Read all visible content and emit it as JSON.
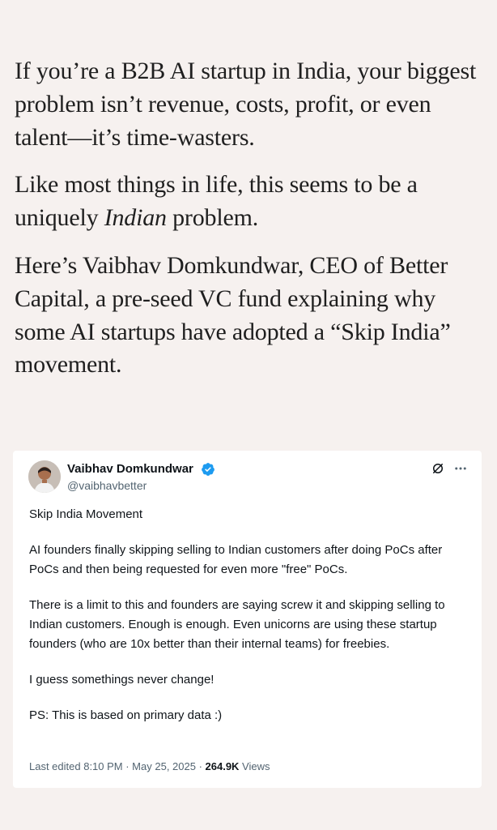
{
  "article": {
    "paragraph_1": "If you’re a B2B AI startup in India, your biggest problem isn’t revenue, costs, profit, or even talent—it’s time-wasters.",
    "paragraph_2_before": "Like most things in life, this seems to be a uniquely ",
    "paragraph_2_emphasis": "Indian",
    "paragraph_2_after": " problem.",
    "paragraph_3": "Here’s Vaibhav Domkundwar, CEO of Better Capital, a pre-seed VC fund explaining why some AI startups have adopted a “Skip India” movement."
  },
  "tweet": {
    "author_name": "Vaibhav Domkundwar",
    "author_handle": "@vaibhavbetter",
    "verified": true,
    "icons": {
      "verified": "verified-badge-icon",
      "grok": "grok-icon",
      "more": "more-options-icon"
    },
    "body": {
      "line_1": "Skip India Movement",
      "line_2": "AI founders finally skipping selling to Indian customers after doing PoCs after PoCs and then being requested for even more \"free\" PoCs.",
      "line_3": "There is a limit to this and founders are saying screw it and skipping selling to Indian customers. Enough is enough. Even unicorns are using these startup founders (who are 10x better than their internal teams) for freebies.",
      "line_4": "I guess somethings never change!",
      "line_5": "PS: This is based on primary data :)"
    },
    "meta": {
      "edited_prefix": "Last edited 8:10 PM · May 25, 2025 · ",
      "views_count": "264.9K",
      "views_label": " Views"
    }
  },
  "colors": {
    "background": "#f6f1ef",
    "article_text": "#1f1f1f",
    "tweet_bg": "#ffffff",
    "muted": "#536471",
    "verified_blue": "#1d9bf0"
  }
}
